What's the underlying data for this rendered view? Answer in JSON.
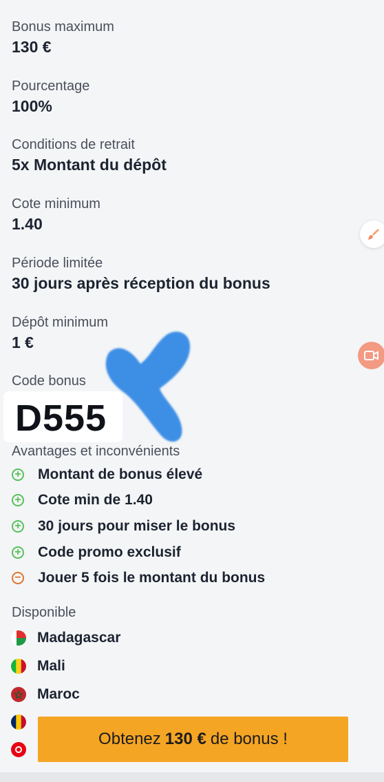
{
  "details": [
    {
      "label": "Bonus maximum",
      "value": "130 €"
    },
    {
      "label": "Pourcentage",
      "value": "100%"
    },
    {
      "label": "Conditions de retrait",
      "value": "5x Montant du dépôt"
    },
    {
      "label": "Cote minimum",
      "value": "1.40"
    },
    {
      "label": "Période limitée",
      "value": "30 jours après réception du bonus"
    },
    {
      "label": "Dépôt minimum",
      "value": "1 €"
    }
  ],
  "code": {
    "label": "Code bonus",
    "value": "D555"
  },
  "pros_cons": {
    "label": "Avantages et inconvénients",
    "items": [
      {
        "type": "pro",
        "text": "Montant de bonus élevé"
      },
      {
        "type": "pro",
        "text": "Cote min de 1.40"
      },
      {
        "type": "pro",
        "text": "30 jours pour miser le bonus"
      },
      {
        "type": "pro",
        "text": "Code promo exclusif"
      },
      {
        "type": "con",
        "text": "Jouer 5 fois le montant du bonus"
      }
    ]
  },
  "available": {
    "label": "Disponible",
    "countries": [
      {
        "name": "Madagascar",
        "icon": "flag-madagascar-icon"
      },
      {
        "name": "Mali",
        "icon": "flag-mali-icon"
      },
      {
        "name": "Maroc",
        "icon": "flag-morocco-icon"
      }
    ]
  },
  "cta": {
    "prefix": "Obtenez",
    "amount": "130 €",
    "suffix": "de bonus !"
  },
  "colors": {
    "accent": "#f5a524",
    "pro": "#55c25a",
    "con": "#e2742c",
    "overlay_blob": "#3d8fe6"
  }
}
